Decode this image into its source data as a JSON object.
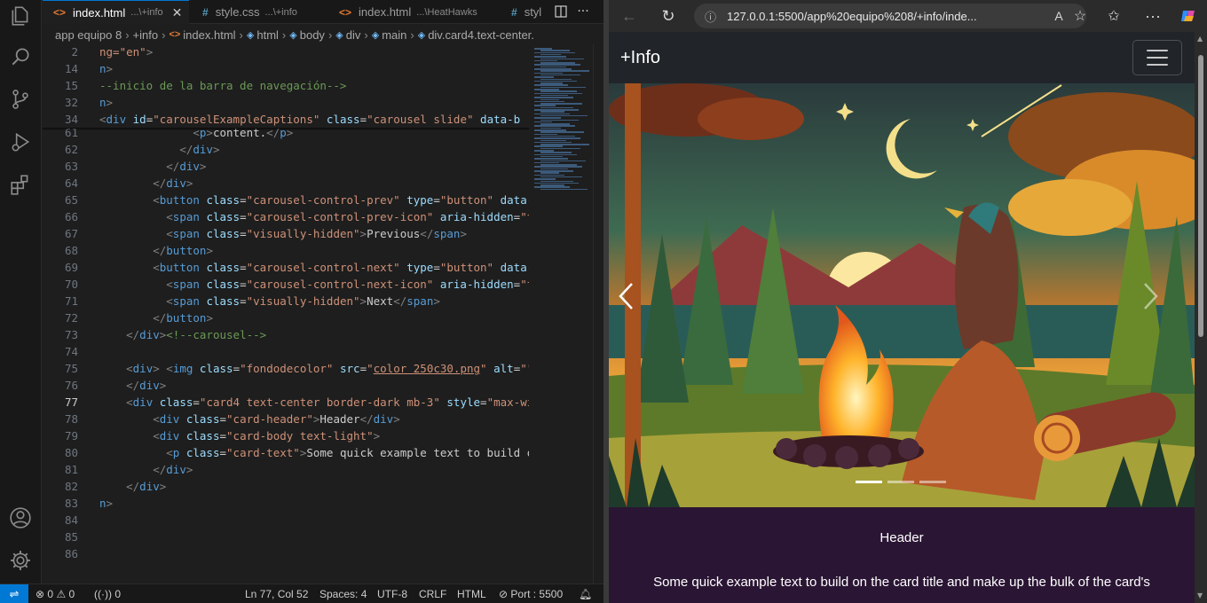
{
  "vscode": {
    "activity_icons": [
      "explorer-icon",
      "search-icon",
      "source-control-icon",
      "run-debug-icon",
      "extensions-icon",
      "accounts-icon",
      "manage-gear-icon"
    ],
    "tabs": [
      {
        "icon": "<>",
        "name": "index.html",
        "desc": "...\\+info",
        "active": true
      },
      {
        "icon": "#",
        "name": "style.css",
        "desc": "...\\+info",
        "active": false
      },
      {
        "icon": "<>",
        "name": "index.html",
        "desc": "...\\HeatHawks",
        "active": false
      },
      {
        "icon": "#",
        "name": "styl",
        "desc": "",
        "active": false
      }
    ],
    "breadcrumb": [
      "app equipo 8",
      "+info",
      "index.html",
      "html",
      "body",
      "div",
      "main",
      "div.card4.text-center."
    ],
    "status": {
      "errors": "0",
      "warnings": "0",
      "ports_forwarded": "0",
      "position": "Ln 77, Col 52",
      "spaces": "Spaces: 4",
      "encoding": "UTF-8",
      "eol": "CRLF",
      "language": "HTML",
      "port": "Port : 5500"
    }
  },
  "browser": {
    "url": "127.0.0.1:5500/app%20equipo%208/+info/inde...",
    "page": {
      "brand": "+Info",
      "carousel_indicators": 3,
      "card_header": "Header",
      "card_text": "Some quick example text to build on the card title and make up the bulk of the card's"
    }
  },
  "code": {
    "sticky": [
      {
        "n": "2",
        "html": "<span class=\"s\">ng=\"en\"</span><span class=\"p\">&gt;</span>"
      },
      {
        "n": "14",
        "html": "<span class=\"t\">n</span><span class=\"p\">&gt;</span>"
      },
      {
        "n": "15",
        "html": "<span class=\"c\">--inicio de la barra de navegaci&oacute;n--&gt;</span>"
      },
      {
        "n": "32",
        "html": "<span class=\"t\">n</span><span class=\"p\">&gt;</span>"
      },
      {
        "n": "34",
        "html": "<span class=\"p\">&lt;</span><span class=\"t\">div</span> <span class=\"a\">id</span><span class=\"x\">=</span><span class=\"s\">\"carouselExampleCaptions\"</span> <span class=\"a\">class</span><span class=\"x\">=</span><span class=\"s\">\"carousel slide\"</span> <span class=\"a\">data-b</span>"
      }
    ],
    "lines": [
      {
        "n": "61",
        "html": "              <span class=\"p\">&lt;</span><span class=\"t\">p</span><span class=\"p\">&gt;</span>content.<span class=\"p\">&lt;/</span><span class=\"t\">p</span><span class=\"p\">&gt;</span>"
      },
      {
        "n": "62",
        "html": "            <span class=\"p\">&lt;/</span><span class=\"t\">div</span><span class=\"p\">&gt;</span>"
      },
      {
        "n": "63",
        "html": "          <span class=\"p\">&lt;/</span><span class=\"t\">div</span><span class=\"p\">&gt;</span>"
      },
      {
        "n": "64",
        "html": "        <span class=\"p\">&lt;/</span><span class=\"t\">div</span><span class=\"p\">&gt;</span>"
      },
      {
        "n": "65",
        "html": "        <span class=\"p\">&lt;</span><span class=\"t\">button</span> <span class=\"a\">class</span><span class=\"x\">=</span><span class=\"s\">\"carousel-control-prev\"</span> <span class=\"a\">type</span><span class=\"x\">=</span><span class=\"s\">\"button\"</span> <span class=\"a\">data-bs</span>"
      },
      {
        "n": "66",
        "html": "          <span class=\"p\">&lt;</span><span class=\"t\">span</span> <span class=\"a\">class</span><span class=\"x\">=</span><span class=\"s\">\"carousel-control-prev-icon\"</span> <span class=\"a\">aria-hidden</span><span class=\"x\">=</span><span class=\"s\">\"tru</span>"
      },
      {
        "n": "67",
        "html": "          <span class=\"p\">&lt;</span><span class=\"t\">span</span> <span class=\"a\">class</span><span class=\"x\">=</span><span class=\"s\">\"visually-hidden\"</span><span class=\"p\">&gt;</span>Previous<span class=\"p\">&lt;/</span><span class=\"t\">span</span><span class=\"p\">&gt;</span>"
      },
      {
        "n": "68",
        "html": "        <span class=\"p\">&lt;/</span><span class=\"t\">button</span><span class=\"p\">&gt;</span>"
      },
      {
        "n": "69",
        "html": "        <span class=\"p\">&lt;</span><span class=\"t\">button</span> <span class=\"a\">class</span><span class=\"x\">=</span><span class=\"s\">\"carousel-control-next\"</span> <span class=\"a\">type</span><span class=\"x\">=</span><span class=\"s\">\"button\"</span> <span class=\"a\">data-bs</span>"
      },
      {
        "n": "70",
        "html": "          <span class=\"p\">&lt;</span><span class=\"t\">span</span> <span class=\"a\">class</span><span class=\"x\">=</span><span class=\"s\">\"carousel-control-next-icon\"</span> <span class=\"a\">aria-hidden</span><span class=\"x\">=</span><span class=\"s\">\"tru</span>"
      },
      {
        "n": "71",
        "html": "          <span class=\"p\">&lt;</span><span class=\"t\">span</span> <span class=\"a\">class</span><span class=\"x\">=</span><span class=\"s\">\"visually-hidden\"</span><span class=\"p\">&gt;</span>Next<span class=\"p\">&lt;/</span><span class=\"t\">span</span><span class=\"p\">&gt;</span>"
      },
      {
        "n": "72",
        "html": "        <span class=\"p\">&lt;/</span><span class=\"t\">button</span><span class=\"p\">&gt;</span>"
      },
      {
        "n": "73",
        "html": "    <span class=\"p\">&lt;/</span><span class=\"t\">div</span><span class=\"p\">&gt;</span><span class=\"c\">&lt;!--carousel--&gt;</span>"
      },
      {
        "n": "74",
        "html": ""
      },
      {
        "n": "75",
        "html": "    <span class=\"p\">&lt;</span><span class=\"t\">div</span><span class=\"p\">&gt;</span> <span class=\"p\">&lt;</span><span class=\"t\">img</span> <span class=\"a\">class</span><span class=\"x\">=</span><span class=\"s\">\"fondodecolor\"</span> <span class=\"a\">src</span><span class=\"x\">=</span><span class=\"s\">\"<span class=\"u\">color 250c30.png</span>\"</span> <span class=\"a\">alt</span><span class=\"x\">=</span><span class=\"s\">\"\"</span>"
      },
      {
        "n": "76",
        "html": "    <span class=\"p\">&lt;/</span><span class=\"t\">div</span><span class=\"p\">&gt;</span>"
      },
      {
        "n": "77",
        "html": "    <span class=\"p\">&lt;</span><span class=\"t\">div</span> <span class=\"a\">class</span><span class=\"x\">=</span><span class=\"s\">\"card4 text-center border-dark mb-3\"</span> <span class=\"a\">style</span><span class=\"x\">=</span><span class=\"s\">\"max-wi</span>",
        "current": true
      },
      {
        "n": "78",
        "html": "        <span class=\"p\">&lt;</span><span class=\"t\">div</span> <span class=\"a\">class</span><span class=\"x\">=</span><span class=\"s\">\"card-header\"</span><span class=\"p\">&gt;</span>Header<span class=\"p\">&lt;/</span><span class=\"t\">div</span><span class=\"p\">&gt;</span>"
      },
      {
        "n": "79",
        "html": "        <span class=\"p\">&lt;</span><span class=\"t\">div</span> <span class=\"a\">class</span><span class=\"x\">=</span><span class=\"s\">\"card-body text-light\"</span><span class=\"p\">&gt;</span>"
      },
      {
        "n": "80",
        "html": "          <span class=\"p\">&lt;</span><span class=\"t\">p</span> <span class=\"a\">class</span><span class=\"x\">=</span><span class=\"s\">\"card-text\"</span><span class=\"p\">&gt;</span>Some quick example text to build on t"
      },
      {
        "n": "81",
        "html": "        <span class=\"p\">&lt;/</span><span class=\"t\">div</span><span class=\"p\">&gt;</span>"
      },
      {
        "n": "82",
        "html": "    <span class=\"p\">&lt;/</span><span class=\"t\">div</span><span class=\"p\">&gt;</span>"
      },
      {
        "n": "83",
        "html": "<span class=\"t\">n</span><span class=\"p\">&gt;</span>"
      },
      {
        "n": "84",
        "html": ""
      },
      {
        "n": "85",
        "html": ""
      },
      {
        "n": "86",
        "html": ""
      }
    ]
  }
}
